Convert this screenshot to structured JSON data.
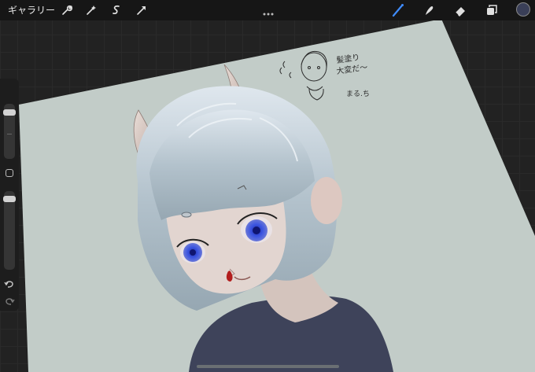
{
  "toolbar": {
    "gallery_label": "ギャラリー",
    "tools": [
      "wrench-icon",
      "magic-wand-icon",
      "selection-icon",
      "transform-arrow-icon"
    ],
    "right_tools": [
      "brush-icon",
      "smudge-icon",
      "eraser-icon",
      "layers-icon"
    ],
    "active_tool": "brush-icon",
    "active_color": "#3a3f58",
    "accent_color": "#3f8cff"
  },
  "sidebar": {
    "brush_size_level": 0.12,
    "opacity_level": 0.06,
    "buttons": [
      "modify-button",
      "undo-button",
      "redo-button"
    ]
  },
  "canvas": {
    "background_color": "#c2ccc8",
    "sketch_note_line1": "髪塗り",
    "sketch_note_line2": "大変だ〜",
    "sketch_note_line3": "まる.ち"
  }
}
